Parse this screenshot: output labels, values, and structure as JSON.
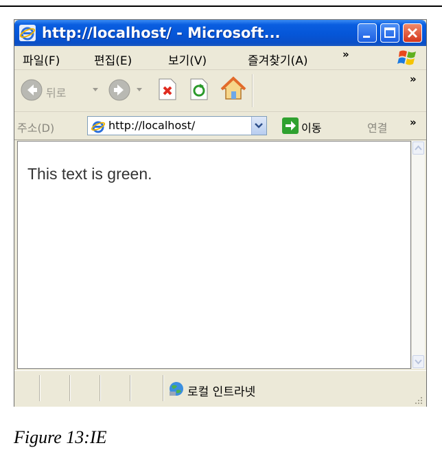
{
  "window": {
    "title": "http://localhost/ - Microsoft..."
  },
  "menu": {
    "items": [
      "파일(F)",
      "편집(E)",
      "보기(V)",
      "즐겨찾기(A)"
    ],
    "more": "»"
  },
  "toolbar": {
    "back_label": "뒤로",
    "more": "»"
  },
  "address": {
    "label": "주소(D)",
    "value": "http://localhost/",
    "go_label": "이동",
    "links_label": "연결",
    "more": "»"
  },
  "content": {
    "text": "This text is green."
  },
  "status": {
    "zone": "로컬 인트라넷"
  },
  "caption": "Figure 13:IE"
}
